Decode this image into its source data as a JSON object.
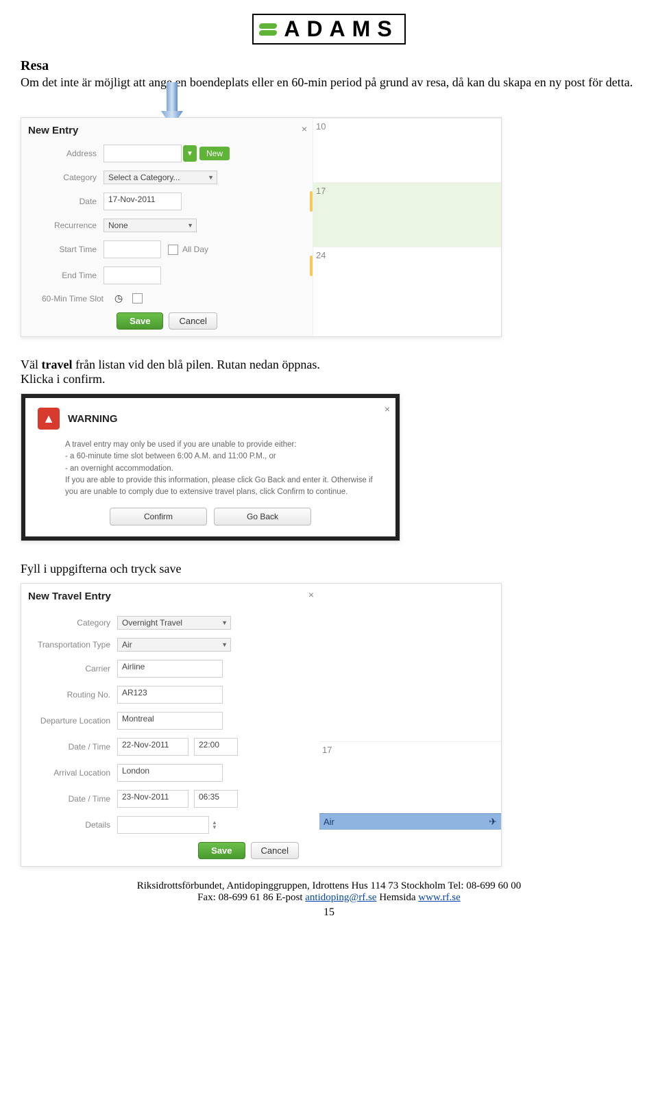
{
  "logo": {
    "text": "ADAMS"
  },
  "section1": {
    "title": "Resa",
    "p1": "Om det inte är möjligt att ange en boendeplats eller en 60-min period på grund av resa, då kan du skapa en ny post för detta."
  },
  "newEntry": {
    "title": "New Entry",
    "labels": {
      "address": "Address",
      "category": "Category",
      "date": "Date",
      "recurrence": "Recurrence",
      "startTime": "Start Time",
      "endTime": "End Time",
      "slot": "60-Min Time Slot"
    },
    "values": {
      "categoryPlaceholder": "Select a Category...",
      "date": "17-Nov-2011",
      "recurrence": "None",
      "allDay": "All Day"
    },
    "buttons": {
      "new": "New",
      "save": "Save",
      "cancel": "Cancel"
    },
    "calendar": {
      "d10": "10",
      "d17": "17",
      "d24": "24"
    }
  },
  "section2": {
    "p": "Väl travel från listan vid den blå pilen. Rutan nedan öppnas.",
    "p2": "Klicka i confirm."
  },
  "warning": {
    "title": "WARNING",
    "body1": "A travel entry may only be used if you are unable to provide either:",
    "body2": "- a 60-minute time slot between 6:00 A.M. and 11:00 P.M., or",
    "body3": "- an overnight accommodation.",
    "body4": "If you are able to provide this information, please click Go Back and enter it. Otherwise if you are unable to comply due to extensive travel plans, click Confirm to continue.",
    "confirm": "Confirm",
    "goBack": "Go Back"
  },
  "section3": {
    "p": "Fyll i uppgifterna och tryck save"
  },
  "travelEntry": {
    "title": "New Travel Entry",
    "labels": {
      "category": "Category",
      "transport": "Transportation Type",
      "carrier": "Carrier",
      "routing": "Routing No.",
      "departure": "Departure Location",
      "datetime": "Date / Time",
      "arrival": "Arrival Location",
      "details": "Details"
    },
    "values": {
      "category": "Overnight Travel",
      "transport": "Air",
      "carrier": "Airline",
      "routing": "AR123",
      "departure": "Montreal",
      "depDate": "22-Nov-2011",
      "depTime": "22:00",
      "arrival": "London",
      "arrDate": "23-Nov-2011",
      "arrTime": "06:35"
    },
    "buttons": {
      "save": "Save",
      "cancel": "Cancel"
    },
    "calendar": {
      "d17": "17",
      "chip": "Air"
    }
  },
  "footer": {
    "line1a": "Riksidrottsförbundet, Antidopinggruppen, Idrottens Hus 114 73 Stockholm Tel: 08-699 60 00",
    "line2a": "Fax: 08-699 61 86 E-post ",
    "email": "antidoping@rf.se",
    "line2b": " Hemsida ",
    "site": "www.rf.se",
    "page": "15"
  }
}
